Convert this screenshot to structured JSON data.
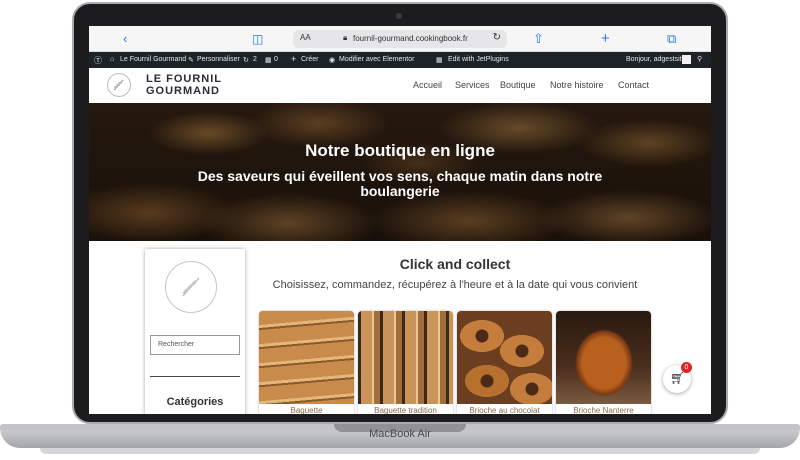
{
  "device": {
    "model": "MacBook Air"
  },
  "browser": {
    "url": "fournil-gourmand.cookingbook.fr",
    "text_size_label": "AA"
  },
  "admin_bar": {
    "site_name": "Le Fournil Gourmand",
    "customize": "Personnaliser",
    "updates_count": "2",
    "comments_count": "0",
    "new_label": "Créer",
    "elementor_label": "Modifier avec Elementor",
    "jetplugins_label": "Edit with JetPlugins",
    "greeting": "Bonjour, adgestsite"
  },
  "site": {
    "brand_line1": "LE FOURNIL",
    "brand_line2": "GOURMAND",
    "nav": [
      "Accueil",
      "Services",
      "Boutique",
      "Notre histoire",
      "Contact"
    ]
  },
  "hero": {
    "title": "Notre boutique en ligne",
    "subtitle": "Des saveurs qui éveillent vos sens, chaque matin dans notre boulangerie"
  },
  "sidebar": {
    "search_placeholder": "Rechercher",
    "categories_title": "Catégories"
  },
  "main": {
    "title": "Click and collect",
    "subtitle": "Choisissez, commandez, récupérez à l'heure et à la date qui vous convient",
    "products": [
      {
        "name": "Baguette"
      },
      {
        "name": "Baguette tradition"
      },
      {
        "name": "Brioche au chocolat"
      },
      {
        "name": "Brioche Nanterre"
      }
    ]
  },
  "cart": {
    "count": "0"
  },
  "icons": {
    "back": "chevron-left-icon",
    "sidebar": "sidebar-icon",
    "share": "share-icon",
    "new_tab": "plus-icon",
    "tabs": "tabs-icon",
    "cart": "basket-icon"
  }
}
